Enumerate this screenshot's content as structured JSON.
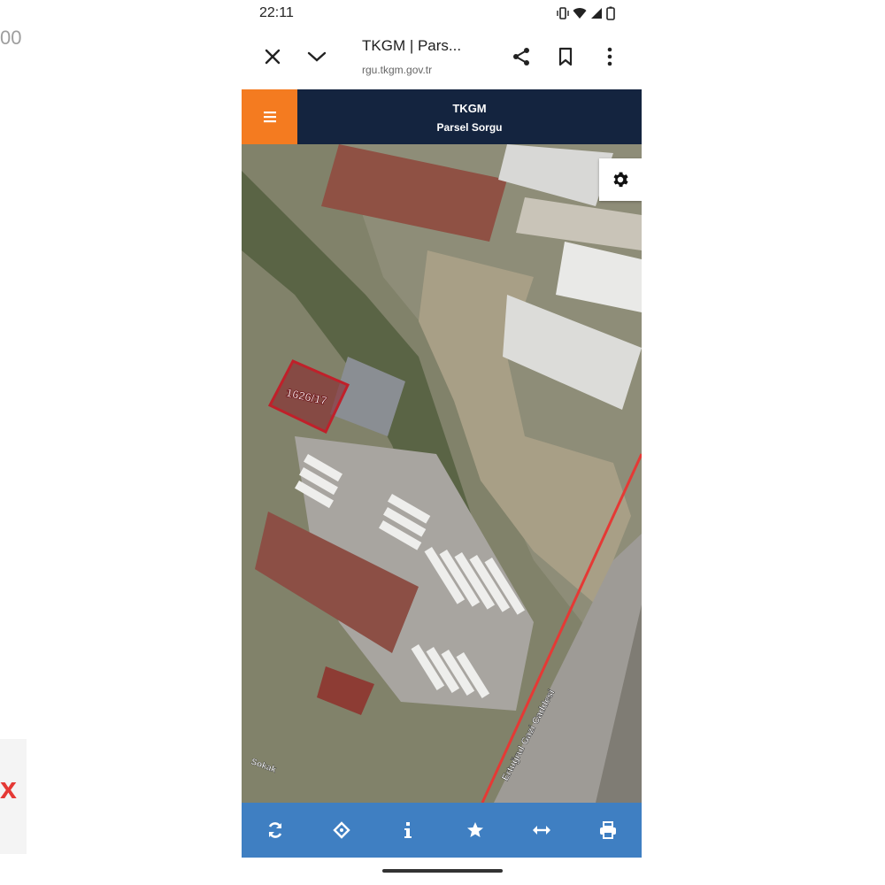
{
  "outside": {
    "left_fragment": "00",
    "left_mark": "x"
  },
  "status_bar": {
    "time": "22:11",
    "icons": [
      "vibrate-icon",
      "wifi-icon",
      "signal-icon",
      "battery-icon"
    ]
  },
  "browser": {
    "tab_title": "TKGM | Pars...",
    "url": "rgu.tkgm.gov.tr",
    "icons": [
      "close-icon",
      "chevron-down-icon",
      "share-icon",
      "bookmark-icon",
      "more-icon"
    ]
  },
  "app": {
    "title": "TKGM",
    "subtitle": "Parsel Sorgu",
    "brand_color": "#14243f",
    "menu_color": "#f47b20",
    "toolbar_color": "#3f7fc2"
  },
  "map": {
    "parcel_label": "1626/17",
    "road_label": "Ertuğrul Gazi Caddesi",
    "street_label": "Sokak",
    "boundary_color": "#e53935"
  },
  "toolbar": {
    "buttons": [
      "refresh-icon",
      "locate-icon",
      "info-icon",
      "star-icon",
      "measure-icon",
      "print-icon"
    ]
  }
}
